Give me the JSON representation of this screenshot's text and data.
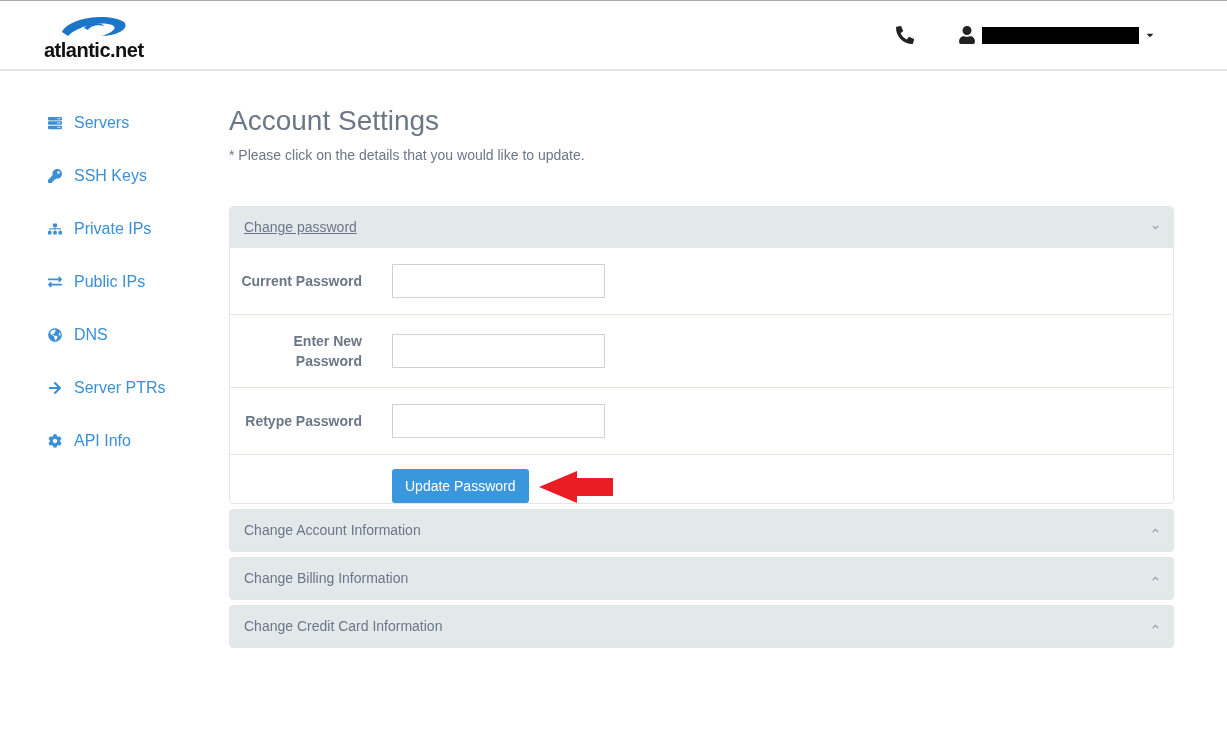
{
  "header": {
    "logo_text": "atlantic.net"
  },
  "sidebar": {
    "items": [
      {
        "label": "Servers",
        "kind": "servers"
      },
      {
        "label": "SSH Keys",
        "kind": "key"
      },
      {
        "label": "Private IPs",
        "kind": "network"
      },
      {
        "label": "Public IPs",
        "kind": "exchange"
      },
      {
        "label": "DNS",
        "kind": "globe"
      },
      {
        "label": "Server PTRs",
        "kind": "arrow"
      },
      {
        "label": "API Info",
        "kind": "gear"
      }
    ]
  },
  "page": {
    "title": "Account Settings",
    "subtitle": "* Please click on the details that you would like to update."
  },
  "sections": [
    {
      "title": "Change password",
      "expanded": true,
      "fields": [
        {
          "label": "Current Password"
        },
        {
          "label": "Enter New Password"
        },
        {
          "label": "Retype Password"
        }
      ],
      "button": "Update Password"
    },
    {
      "title": "Change Account Information",
      "expanded": false
    },
    {
      "title": "Change Billing Information",
      "expanded": false
    },
    {
      "title": "Change Credit Card Information",
      "expanded": false
    }
  ]
}
